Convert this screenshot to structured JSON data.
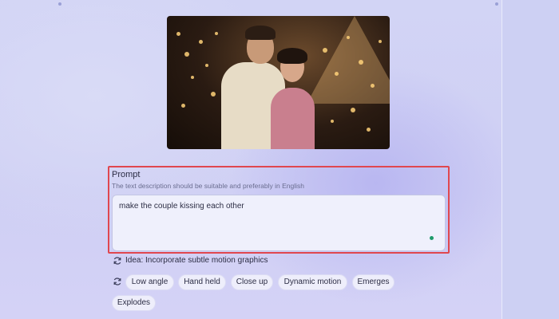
{
  "prompt": {
    "title": "Prompt",
    "hint": "The text description should be suitable and preferably in English",
    "value": "make the couple kissing each other"
  },
  "idea": {
    "text": "Idea: Incorporate subtle motion graphics",
    "icon": "refresh-icon"
  },
  "chips": {
    "refresh_icon": "refresh-icon",
    "items": [
      {
        "label": "Low angle"
      },
      {
        "label": "Hand held"
      },
      {
        "label": "Close up"
      },
      {
        "label": "Dynamic motion"
      },
      {
        "label": "Emerges"
      },
      {
        "label": "Explodes"
      }
    ]
  },
  "colors": {
    "highlight_border": "#e0474f",
    "status_dot": "#1e9a6a",
    "background": "#cfd0f4"
  }
}
